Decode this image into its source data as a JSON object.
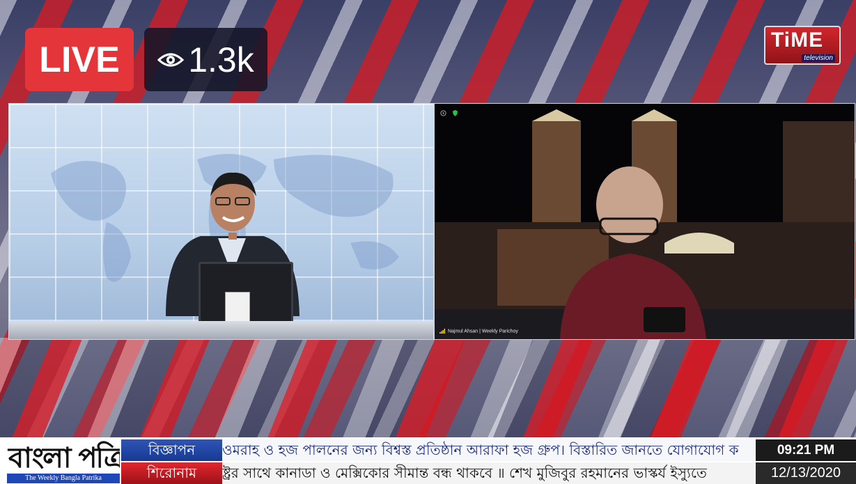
{
  "overlay": {
    "live_label": "LIVE",
    "viewer_count": "1.3k",
    "viewer_icon": "eye-icon"
  },
  "channel": {
    "logo_text": "TiME",
    "logo_subtext": "television"
  },
  "remote_feed": {
    "caller_label": "Najmul Ahsan | Weekly Parichoy"
  },
  "ticker": {
    "paper_name_bn": "বাংলা পত্রিকা",
    "paper_name_en": "The Weekly Bangla Patrika",
    "ad_label": "বিজ্ঞাপন",
    "ad_text": "ওমরাহ ও হজ পালনের জন্য বিশ্বস্ত প্রতিষ্ঠান আরাফা হজ গ্রুপ। বিস্তারিত জানতে যোগাযোগ ক",
    "headline_label": "শিরোনাম",
    "headline_text": "ষ্ট্রর সাথে কানাডা ও মেক্সিকোর সীমান্ত বন্ধ থাকবে ॥ শেখ মুজিবুর রহমানের ভাস্কর্য ইস্যুতে",
    "time": "09:21 PM",
    "date": "12/13/2020"
  },
  "colors": {
    "live_red": "#e4353b",
    "ad_blue": "#2f54b6",
    "headline_red": "#e2262f"
  }
}
